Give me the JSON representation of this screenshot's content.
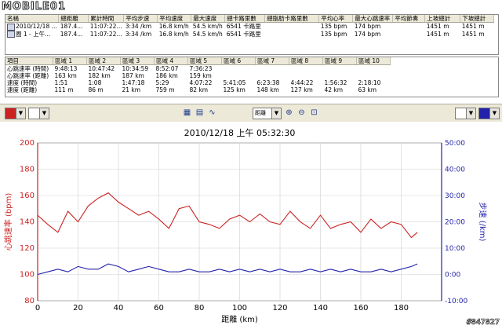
{
  "logo": "MOBILE01",
  "watermark": "#847827",
  "colors": {
    "heart_rate": "#cc2222",
    "speed": "#2222aa",
    "grid": "#cfcfcf"
  },
  "summary_table": {
    "headers": [
      "名稱",
      "總距離",
      "累計時間",
      "平均步速",
      "平均速度",
      "最大速度",
      "總卡路里數",
      "總脂肪卡路里數",
      "平均心率",
      "最大心跳速率",
      "平均節奏",
      "上坡總計",
      "下坡總計"
    ],
    "rows": [
      [
        "2010/12/18 ...",
        "187.4...",
        "11:07:22...",
        "3:34 /km",
        "16.8 km/h",
        "54.5 km/h",
        "6541 卡路里",
        "",
        "135 bpm",
        "174 bpm",
        "",
        "1451 m",
        "1451 m"
      ],
      [
        "圈 1 - 上午...",
        "187.4...",
        "11:07:22...",
        "3:34 /km",
        "16.8 km/h",
        "54.5 km/h",
        "6541 卡路里",
        "",
        "135 bpm",
        "174 bpm",
        "",
        "1451 m",
        "1451 m"
      ]
    ]
  },
  "zone_table": {
    "headers": [
      "項目",
      "區域 1",
      "區域 2",
      "區域 3",
      "區域 4",
      "區域 5",
      "區域 6",
      "區域 7",
      "區域 8",
      "區域 9",
      "區域 10"
    ],
    "rows": [
      [
        "心跳速率 (時間)",
        "9:48:13",
        "10:47:42",
        "10:34:59",
        "8:52:07",
        "7:36:23",
        "",
        "",
        "",
        "",
        ""
      ],
      [
        "心跳速率 (距離)",
        "163 km",
        "182 km",
        "187 km",
        "186 km",
        "159 km",
        "",
        "",
        "",
        "",
        ""
      ],
      [
        "速度 (時間)",
        "1:51",
        "1:08",
        "1:47:18",
        "5:29",
        "4:07:22",
        "5:41:05",
        "6:23:38",
        "4:44:22",
        "1:56:32",
        "2:18:10"
      ],
      [
        "速度 (距離)",
        "111 m",
        "86 m",
        "21 km",
        "759 m",
        "82 km",
        "125 km",
        "148 km",
        "127 km",
        "42 km",
        "63 km"
      ]
    ]
  },
  "toolbar": {
    "x_axis_mode": "距離"
  },
  "chart_data": {
    "type": "line",
    "title": "2010/12/18 上午 05:32:30",
    "xlabel": "距離 (km)",
    "ylabel_left": "心跳速率 (bpm)",
    "ylabel_right": "步速 (/km)",
    "xlim": [
      0,
      200
    ],
    "ylim_left": [
      80,
      200
    ],
    "ylim_right": [
      -10,
      50
    ],
    "x_ticks": [
      0,
      20,
      40,
      60,
      80,
      100,
      120,
      140,
      160,
      180
    ],
    "y_left_ticks": [
      80,
      100,
      120,
      140,
      160,
      180,
      200
    ],
    "y_right_ticks": [
      "-10:00",
      "0:00",
      "10:00",
      "20:00",
      "30:00",
      "40:00",
      "50:00"
    ],
    "grid": true,
    "series": [
      {
        "x": [
          0,
          5,
          10,
          15,
          20,
          25,
          30,
          35,
          40,
          45,
          50,
          55,
          60,
          65,
          70,
          75,
          80,
          85,
          90,
          95,
          100,
          105,
          110,
          115,
          120,
          125,
          130,
          135,
          140,
          145,
          150,
          155,
          160,
          165,
          170,
          175,
          180,
          185,
          188
        ],
        "values": [
          145,
          138,
          132,
          148,
          140,
          152,
          158,
          162,
          155,
          150,
          145,
          148,
          142,
          135,
          150,
          152,
          140,
          138,
          135,
          142,
          145,
          140,
          146,
          140,
          138,
          148,
          140,
          135,
          145,
          135,
          138,
          140,
          132,
          142,
          135,
          140,
          138,
          128,
          132
        ]
      },
      {
        "x": [
          0,
          5,
          10,
          15,
          20,
          25,
          30,
          35,
          40,
          45,
          50,
          55,
          60,
          65,
          70,
          75,
          80,
          85,
          90,
          95,
          100,
          105,
          110,
          115,
          120,
          125,
          130,
          135,
          140,
          145,
          150,
          155,
          160,
          165,
          170,
          175,
          180,
          185,
          188
        ],
        "values": [
          0,
          1,
          2,
          1,
          3,
          2,
          2,
          4,
          3,
          1,
          2,
          3,
          2,
          1,
          1,
          2,
          1,
          1,
          2,
          1,
          2,
          1,
          2,
          1,
          2,
          1,
          1,
          2,
          1,
          2,
          1,
          2,
          1,
          1,
          2,
          1,
          2,
          3,
          4
        ]
      }
    ]
  }
}
